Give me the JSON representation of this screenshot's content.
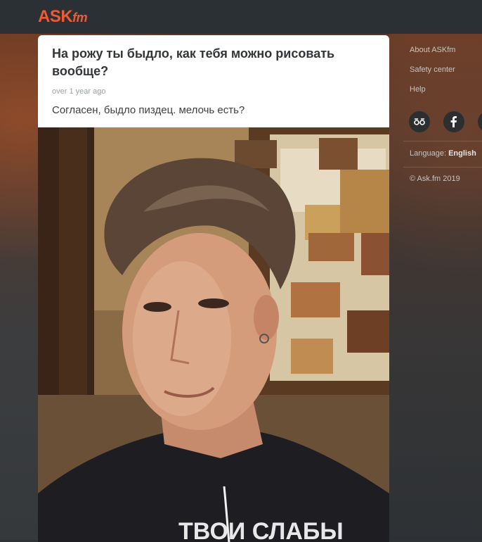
{
  "header": {
    "logo_ask": "ASK",
    "logo_fm": "fm"
  },
  "post": {
    "question": "На рожу ты быдло, как тебя можно рисовать вообще?",
    "time": "over 1 year ago",
    "answer": "Согласен, быдло пиздец. мелочь есть?",
    "shirt_text": "ТВОИ СЛАБЫ"
  },
  "sidebar": {
    "links": [
      "About ASKfm",
      "Safety center",
      "Help"
    ],
    "socials": [
      "vk-icon",
      "facebook-icon",
      "twitter-icon"
    ],
    "language_label": "Language:",
    "language_value": "English",
    "copyright": "© Ask.fm 2019"
  },
  "colors": {
    "brand": "#ee5a36",
    "topbar": "#2b3034"
  }
}
